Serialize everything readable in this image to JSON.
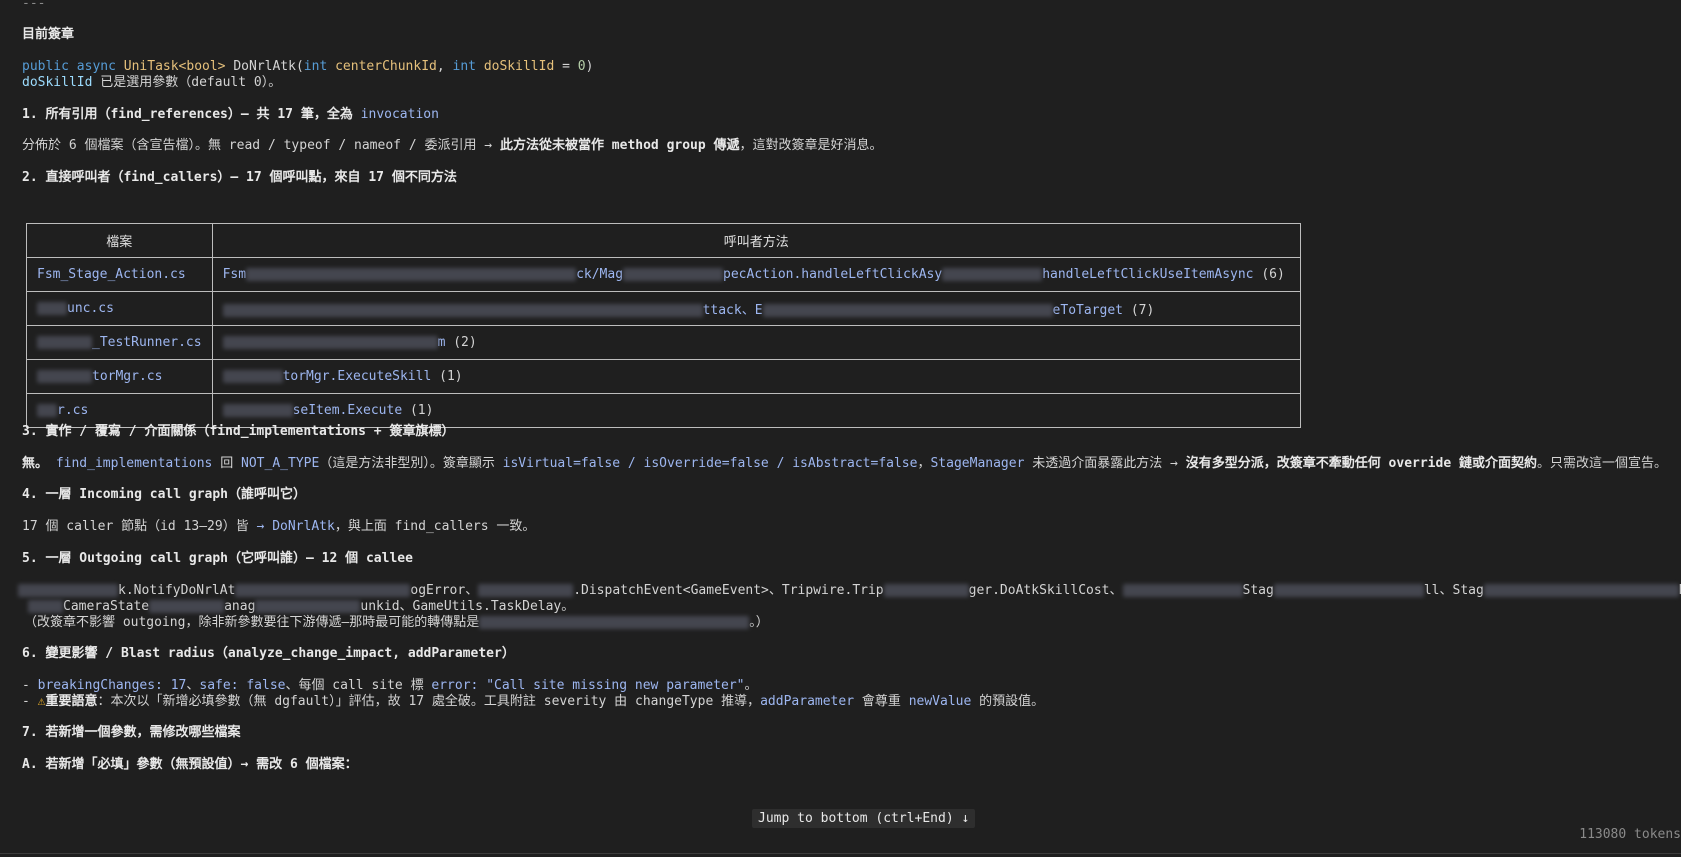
{
  "top_rule": "---",
  "sig": {
    "heading": "目前簽章",
    "code": {
      "kw1": "public",
      "kw2": "async",
      "type": "UniTask<bool>",
      "name": " DoNrlAtk(",
      "t1": "int",
      "p1": " centerChunkId",
      "sep": ", ",
      "t2": "int",
      "p2": " doSkillId",
      "eq": " = ",
      "def": "0",
      "close": ")"
    },
    "note_code": "doSkillId",
    "note_text": " 已是選用參數（default 0）。"
  },
  "s1": {
    "heading": "1. 所有引用（find_references）— 共 17 筆，全為 ",
    "heading_code": "invocation",
    "body_a": "分佈於 6 個檔案（含宣告檔）。無 read / typeof / nameof / 委派引用 → ",
    "body_bold": "此方法從未被當作 method group 傳遞",
    "body_b": "，這對改簽章是好消息。"
  },
  "s2": {
    "heading": "2. 直接呼叫者（find_callers）— 17 個呼叫點，來自 17 個不同方法",
    "th_file": "檔案",
    "th_method": "呼叫者方法",
    "rows": [
      {
        "file": "Fsm_Stage_Action.cs",
        "m1": "Fsm",
        "m2": "ck/Mag",
        "m3": "pecAction.handleLeftClickAsy",
        "m4": "handleLeftClickUseItemAsync",
        "count": " (6)"
      },
      {
        "file": "unc.cs",
        "m1": "",
        "m2": "ttack、E",
        "m3": "",
        "m4": "eToTarget",
        "count": " (7)"
      },
      {
        "file": "_TestRunner.cs",
        "m1": "",
        "m2": "m",
        "m3": "",
        "m4": "",
        "count": " (2)"
      },
      {
        "file": "torMgr.cs",
        "m1": "",
        "m2": "torMgr.ExecuteSkill",
        "m3": "",
        "m4": "",
        "count": " (1)"
      },
      {
        "file": "r.cs",
        "m1": "",
        "m2": "seItem.Execute",
        "m3": "",
        "m4": "",
        "count": " (1)"
      }
    ]
  },
  "s3": {
    "heading": "3. 實作 / 覆寫 / 介面關係（find_implementations + 簽章旗標）",
    "t1": "無。 ",
    "c1": "find_implementations",
    "t2": " 回 ",
    "c2": "NOT_A_TYPE",
    "t3": "（這是方法非型別）。簽章顯示 ",
    "c3": "isVirtual=false / isOverride=false / isAbstract=false",
    "t4": "，",
    "c4": "StageManager",
    "t5": " 未透過介面暴露此方法 → ",
    "b1": "沒有多型分派，改簽章不牽動任何 override 鏈或介面契約",
    "t6": "。只需改這一個宣告。"
  },
  "s4": {
    "heading": "4. 一層 Incoming call graph（誰呼叫它）",
    "t1": "17 個 caller 節點（id 13–29）皆 ",
    "c1": "→ DoNrlAtk",
    "t2": "，與上面 find_callers 一致。"
  },
  "s5": {
    "heading": "5. 一層 Outgoing call graph（它呼叫誰）— 12 個 callee",
    "l1a": "k.NotifyDoNrlAt",
    "l1b": "ogError、",
    "l1c": ".DispatchEvent<GameEvent>",
    "l1d": "、Tripwire.Trip",
    "l1e": "ger.DoAtkSkillCost",
    "l1f": "、",
    "l1g": "Stag",
    "l1h": "ll、Stag",
    "l1i": "D",
    "l1j": "nag",
    "l2a": "CameraState",
    "l2b": "anag",
    "l2c": "unkid",
    "l2d": "、GameUtils.TaskDelay",
    "l2e": "。",
    "l3a": "（改簽章不影響 outgoing，除非新參數要往下游傳遞—那時最可能的轉傳點是",
    "l3b": "。）"
  },
  "s6": {
    "heading": "6. 變更影響 / Blast radius（analyze_change_impact, addParameter）",
    "a_dash": "- ",
    "a_c1": "breakingChanges: 17",
    "a_t1": "、",
    "a_c2": "safe: false",
    "a_t2": "、每個 call site 標 ",
    "a_c3": "error: \"Call site missing new parameter\"",
    "a_t3": "。",
    "b_dash": "- ",
    "b_warn": "⚠",
    "b_bold": "重要語意",
    "b_t1": "：本次以「新增必填參數（無 dgfault）」評估，故 17 處全破。工具附註 severity 由 changeType 推導，",
    "b_c1": "addParameter",
    "b_t2": " 會尊重 ",
    "b_c2": "newValue",
    "b_t3": " 的預設值。"
  },
  "s7": {
    "heading": "7. 若新增一個參數，需修改哪些檔案",
    "sub": "A. 若新增「必填」參數（無預設值）→ 需改 6 個檔案："
  },
  "jump_label": "Jump to bottom (ctrl+End) ↓",
  "tokens": "113080 tokens"
}
